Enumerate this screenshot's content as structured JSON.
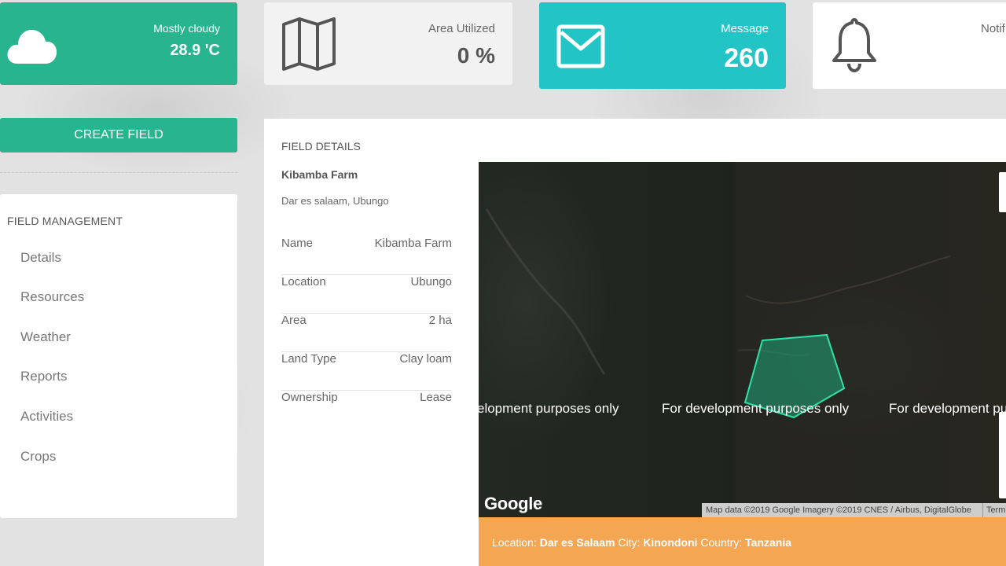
{
  "stats": {
    "weather": {
      "label": "Mostly cloudy",
      "value": "28.9 'C",
      "icon": "cloud-icon",
      "color": "#27b48f"
    },
    "area": {
      "label": "Area Utilized",
      "value": "0 %",
      "icon": "map-icon"
    },
    "message": {
      "label": "Message",
      "value": "260",
      "icon": "envelope-icon",
      "color": "#23c4c6"
    },
    "notification": {
      "label": "Notif",
      "icon": "bell-icon"
    }
  },
  "sidebar": {
    "create_button": "CREATE FIELD",
    "menu_title": "FIELD MANAGEMENT",
    "items": [
      {
        "label": "Details"
      },
      {
        "label": "Resources"
      },
      {
        "label": "Weather"
      },
      {
        "label": "Reports"
      },
      {
        "label": "Activities"
      },
      {
        "label": "Crops"
      }
    ]
  },
  "field_details": {
    "title": "FIELD DETAILS",
    "farm_name": "Kibamba Farm",
    "address": "Dar es salaam, Ubungo",
    "rows": [
      {
        "key": "Name",
        "value": "Kibamba Farm"
      },
      {
        "key": "Location",
        "value": "Ubungo"
      },
      {
        "key": "Area",
        "value": "2 ha"
      },
      {
        "key": "Land Type",
        "value": "Clay loam"
      },
      {
        "key": "Ownership",
        "value": "Lease"
      }
    ]
  },
  "map": {
    "watermarks": [
      "elopment purposes only",
      "For development purposes only",
      "For development purp"
    ],
    "logo": "Google",
    "attribution": "Map data ©2019 Google Imagery ©2019 CNES / Airbus, DigitalGlobe",
    "terms": "Term",
    "polygon_color": "#1fa77a"
  },
  "location_bar": {
    "location_label": "Location:",
    "location_value": "Dar es Salaam",
    "city_label": "City:",
    "city_value": "Kinondoni",
    "country_label": "Country:",
    "country_value": "Tanzania",
    "color": "#f5a653"
  }
}
